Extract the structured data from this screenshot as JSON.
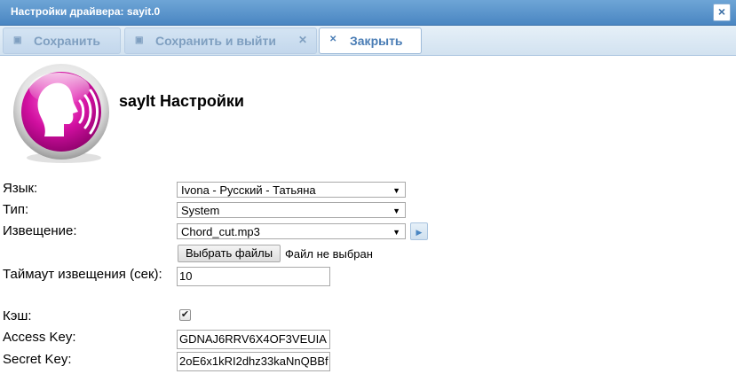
{
  "window": {
    "title": "Настройки драйвера: sayit.0",
    "close_icon": "close-icon"
  },
  "toolbar": {
    "save_label": "Сохранить",
    "save_exit_label": "Сохранить и выйти",
    "close_label": "Закрыть"
  },
  "header": {
    "title": "sayIt Настройки",
    "logo": "speaking-head-logo"
  },
  "form": {
    "language": {
      "label": "Язык:",
      "value": "Ivona - Русский - Татьяна"
    },
    "type": {
      "label": "Тип:",
      "value": "System"
    },
    "announce": {
      "label": "Извещение:",
      "value": "Chord_cut.mp3"
    },
    "file": {
      "button": "Выбрать файлы",
      "status": "Файл не выбран"
    },
    "timeout": {
      "label": "Таймаут извещения (сек):",
      "value": "10"
    },
    "cache": {
      "label": "Кэш:",
      "checked": true
    },
    "access_key": {
      "label": "Access Key:",
      "value": "GDNAJ6RRV6X4OF3VEUIA"
    },
    "secret_key": {
      "label": "Secret Key:",
      "value": "2oE6x1kRI2dhz33kaNnQBBf"
    }
  },
  "colors": {
    "accent": "#4a86c2",
    "logo": "#d10fa0"
  }
}
